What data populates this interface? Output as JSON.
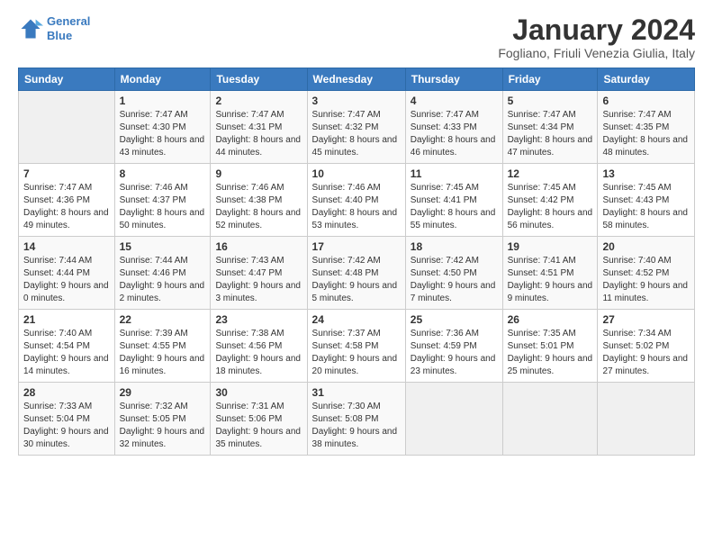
{
  "header": {
    "logo_line1": "General",
    "logo_line2": "Blue",
    "title": "January 2024",
    "subtitle": "Fogliano, Friuli Venezia Giulia, Italy"
  },
  "weekdays": [
    "Sunday",
    "Monday",
    "Tuesday",
    "Wednesday",
    "Thursday",
    "Friday",
    "Saturday"
  ],
  "weeks": [
    [
      {
        "day": "",
        "sunrise": "",
        "sunset": "",
        "daylight": ""
      },
      {
        "day": "1",
        "sunrise": "Sunrise: 7:47 AM",
        "sunset": "Sunset: 4:30 PM",
        "daylight": "Daylight: 8 hours and 43 minutes."
      },
      {
        "day": "2",
        "sunrise": "Sunrise: 7:47 AM",
        "sunset": "Sunset: 4:31 PM",
        "daylight": "Daylight: 8 hours and 44 minutes."
      },
      {
        "day": "3",
        "sunrise": "Sunrise: 7:47 AM",
        "sunset": "Sunset: 4:32 PM",
        "daylight": "Daylight: 8 hours and 45 minutes."
      },
      {
        "day": "4",
        "sunrise": "Sunrise: 7:47 AM",
        "sunset": "Sunset: 4:33 PM",
        "daylight": "Daylight: 8 hours and 46 minutes."
      },
      {
        "day": "5",
        "sunrise": "Sunrise: 7:47 AM",
        "sunset": "Sunset: 4:34 PM",
        "daylight": "Daylight: 8 hours and 47 minutes."
      },
      {
        "day": "6",
        "sunrise": "Sunrise: 7:47 AM",
        "sunset": "Sunset: 4:35 PM",
        "daylight": "Daylight: 8 hours and 48 minutes."
      }
    ],
    [
      {
        "day": "7",
        "sunrise": "Sunrise: 7:47 AM",
        "sunset": "Sunset: 4:36 PM",
        "daylight": "Daylight: 8 hours and 49 minutes."
      },
      {
        "day": "8",
        "sunrise": "Sunrise: 7:46 AM",
        "sunset": "Sunset: 4:37 PM",
        "daylight": "Daylight: 8 hours and 50 minutes."
      },
      {
        "day": "9",
        "sunrise": "Sunrise: 7:46 AM",
        "sunset": "Sunset: 4:38 PM",
        "daylight": "Daylight: 8 hours and 52 minutes."
      },
      {
        "day": "10",
        "sunrise": "Sunrise: 7:46 AM",
        "sunset": "Sunset: 4:40 PM",
        "daylight": "Daylight: 8 hours and 53 minutes."
      },
      {
        "day": "11",
        "sunrise": "Sunrise: 7:45 AM",
        "sunset": "Sunset: 4:41 PM",
        "daylight": "Daylight: 8 hours and 55 minutes."
      },
      {
        "day": "12",
        "sunrise": "Sunrise: 7:45 AM",
        "sunset": "Sunset: 4:42 PM",
        "daylight": "Daylight: 8 hours and 56 minutes."
      },
      {
        "day": "13",
        "sunrise": "Sunrise: 7:45 AM",
        "sunset": "Sunset: 4:43 PM",
        "daylight": "Daylight: 8 hours and 58 minutes."
      }
    ],
    [
      {
        "day": "14",
        "sunrise": "Sunrise: 7:44 AM",
        "sunset": "Sunset: 4:44 PM",
        "daylight": "Daylight: 9 hours and 0 minutes."
      },
      {
        "day": "15",
        "sunrise": "Sunrise: 7:44 AM",
        "sunset": "Sunset: 4:46 PM",
        "daylight": "Daylight: 9 hours and 2 minutes."
      },
      {
        "day": "16",
        "sunrise": "Sunrise: 7:43 AM",
        "sunset": "Sunset: 4:47 PM",
        "daylight": "Daylight: 9 hours and 3 minutes."
      },
      {
        "day": "17",
        "sunrise": "Sunrise: 7:42 AM",
        "sunset": "Sunset: 4:48 PM",
        "daylight": "Daylight: 9 hours and 5 minutes."
      },
      {
        "day": "18",
        "sunrise": "Sunrise: 7:42 AM",
        "sunset": "Sunset: 4:50 PM",
        "daylight": "Daylight: 9 hours and 7 minutes."
      },
      {
        "day": "19",
        "sunrise": "Sunrise: 7:41 AM",
        "sunset": "Sunset: 4:51 PM",
        "daylight": "Daylight: 9 hours and 9 minutes."
      },
      {
        "day": "20",
        "sunrise": "Sunrise: 7:40 AM",
        "sunset": "Sunset: 4:52 PM",
        "daylight": "Daylight: 9 hours and 11 minutes."
      }
    ],
    [
      {
        "day": "21",
        "sunrise": "Sunrise: 7:40 AM",
        "sunset": "Sunset: 4:54 PM",
        "daylight": "Daylight: 9 hours and 14 minutes."
      },
      {
        "day": "22",
        "sunrise": "Sunrise: 7:39 AM",
        "sunset": "Sunset: 4:55 PM",
        "daylight": "Daylight: 9 hours and 16 minutes."
      },
      {
        "day": "23",
        "sunrise": "Sunrise: 7:38 AM",
        "sunset": "Sunset: 4:56 PM",
        "daylight": "Daylight: 9 hours and 18 minutes."
      },
      {
        "day": "24",
        "sunrise": "Sunrise: 7:37 AM",
        "sunset": "Sunset: 4:58 PM",
        "daylight": "Daylight: 9 hours and 20 minutes."
      },
      {
        "day": "25",
        "sunrise": "Sunrise: 7:36 AM",
        "sunset": "Sunset: 4:59 PM",
        "daylight": "Daylight: 9 hours and 23 minutes."
      },
      {
        "day": "26",
        "sunrise": "Sunrise: 7:35 AM",
        "sunset": "Sunset: 5:01 PM",
        "daylight": "Daylight: 9 hours and 25 minutes."
      },
      {
        "day": "27",
        "sunrise": "Sunrise: 7:34 AM",
        "sunset": "Sunset: 5:02 PM",
        "daylight": "Daylight: 9 hours and 27 minutes."
      }
    ],
    [
      {
        "day": "28",
        "sunrise": "Sunrise: 7:33 AM",
        "sunset": "Sunset: 5:04 PM",
        "daylight": "Daylight: 9 hours and 30 minutes."
      },
      {
        "day": "29",
        "sunrise": "Sunrise: 7:32 AM",
        "sunset": "Sunset: 5:05 PM",
        "daylight": "Daylight: 9 hours and 32 minutes."
      },
      {
        "day": "30",
        "sunrise": "Sunrise: 7:31 AM",
        "sunset": "Sunset: 5:06 PM",
        "daylight": "Daylight: 9 hours and 35 minutes."
      },
      {
        "day": "31",
        "sunrise": "Sunrise: 7:30 AM",
        "sunset": "Sunset: 5:08 PM",
        "daylight": "Daylight: 9 hours and 38 minutes."
      },
      {
        "day": "",
        "sunrise": "",
        "sunset": "",
        "daylight": ""
      },
      {
        "day": "",
        "sunrise": "",
        "sunset": "",
        "daylight": ""
      },
      {
        "day": "",
        "sunrise": "",
        "sunset": "",
        "daylight": ""
      }
    ]
  ]
}
